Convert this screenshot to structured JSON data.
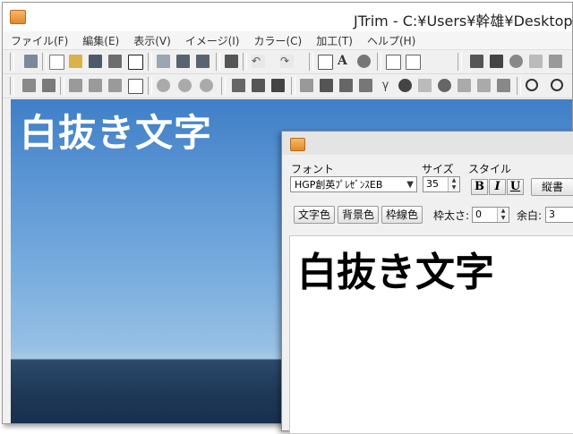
{
  "window": {
    "title": "JTrim - C:¥Users¥幹雄¥Desktop¥"
  },
  "menu": [
    "ファイル(F)",
    "編集(E)",
    "表示(V)",
    "イメージ(I)",
    "カラー(C)",
    "加工(T)",
    "ヘルプ(H)"
  ],
  "canvas": {
    "overlay_text": "白抜き文字"
  },
  "dialog": {
    "font_label": "フォント",
    "size_label": "サイズ",
    "style_label": "スタイル",
    "font_value": "HGP創英ﾌﾟﾚｾﾞﾝｽEB",
    "size_value": "35",
    "bold_label": "B",
    "italic_label": "I",
    "underline_label": "U",
    "vertical_label": "縦書",
    "text_color_button": "文字色",
    "bg_color_button": "背景色",
    "border_color_button": "枠線色",
    "border_width_label": "枠太さ:",
    "border_width_value": "0",
    "margin_label": "余白:",
    "margin_value": "3",
    "preview_text": "白抜き文字"
  },
  "colors": {
    "sky": "#5b95d3",
    "sea": "#1f3958",
    "dialog_bg": "#f0f0f0"
  }
}
